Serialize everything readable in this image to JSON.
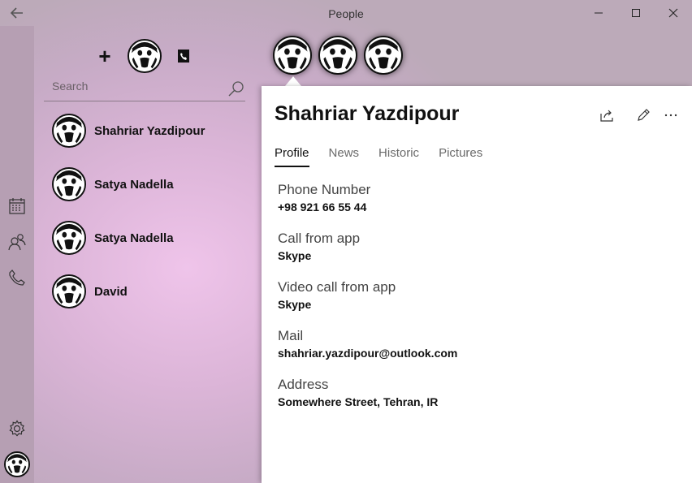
{
  "window": {
    "title": "People"
  },
  "search": {
    "placeholder": "Search"
  },
  "contacts": [
    {
      "name": "Shahriar Yazdipour"
    },
    {
      "name": "Satya Nadella"
    },
    {
      "name": "Satya Nadella"
    },
    {
      "name": "David"
    }
  ],
  "detail": {
    "name": "Shahriar Yazdipour",
    "tabs": [
      "Profile",
      "News",
      "Historic",
      "Pictures"
    ],
    "active_tab": "Profile",
    "fields": [
      {
        "label": "Phone Number",
        "value": "+98 921 66 55 44"
      },
      {
        "label": "Call from app",
        "value": "Skype"
      },
      {
        "label": "Video call from app",
        "value": "Skype"
      },
      {
        "label": "Mail",
        "value": "shahriar.yazdipour@outlook.com"
      },
      {
        "label": "Address",
        "value": "Somewhere Street, Tehran, IR"
      }
    ]
  },
  "toolbar": {
    "add_label": "+"
  },
  "colors": {
    "accent_panel": "#ffffff",
    "rail": "#b69fb3",
    "text": "#111111"
  }
}
